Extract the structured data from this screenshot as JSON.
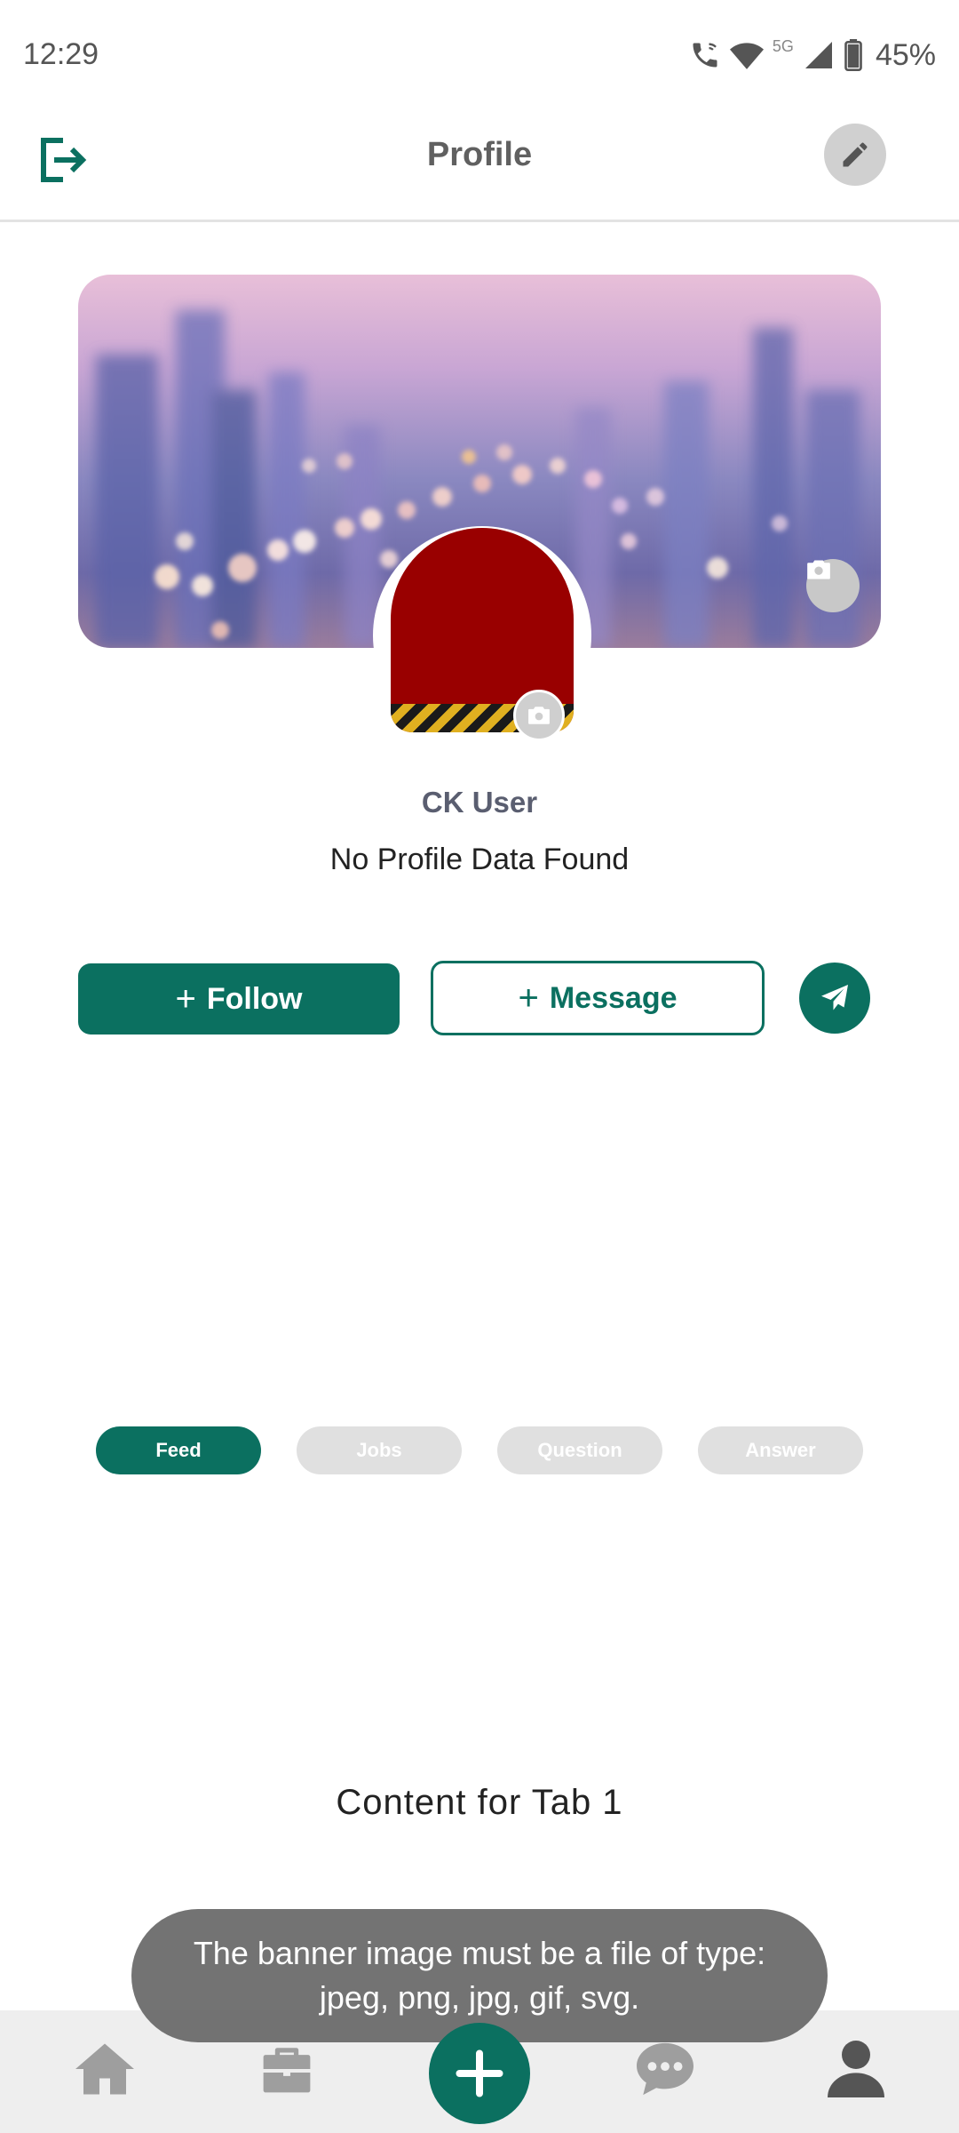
{
  "status_bar": {
    "time": "12:29",
    "network": "5G",
    "battery": "45%"
  },
  "header": {
    "title": "Profile",
    "logout_icon": "logout-icon",
    "edit_icon": "pencil-icon"
  },
  "profile": {
    "name": "CK User",
    "status": "No Profile Data Found"
  },
  "actions": {
    "follow_label": "Follow",
    "message_label": "Message",
    "send_icon": "send-icon"
  },
  "tabs": [
    {
      "label": "Feed",
      "active": true
    },
    {
      "label": "Jobs",
      "active": false
    },
    {
      "label": "Question",
      "active": false
    },
    {
      "label": "Answer",
      "active": false
    }
  ],
  "content": {
    "text": "Content for Tab 1"
  },
  "toast": {
    "message": "The banner image must be a file of type: jpeg, png, jpg, gif, svg."
  },
  "bottom_nav": {
    "items": [
      "home-icon",
      "briefcase-icon",
      "add-icon",
      "chat-icon",
      "user-icon"
    ]
  },
  "colors": {
    "primary": "#0b7060",
    "tab_inactive": "#e0e0e0",
    "nav_icon": "#9e9e9e"
  }
}
